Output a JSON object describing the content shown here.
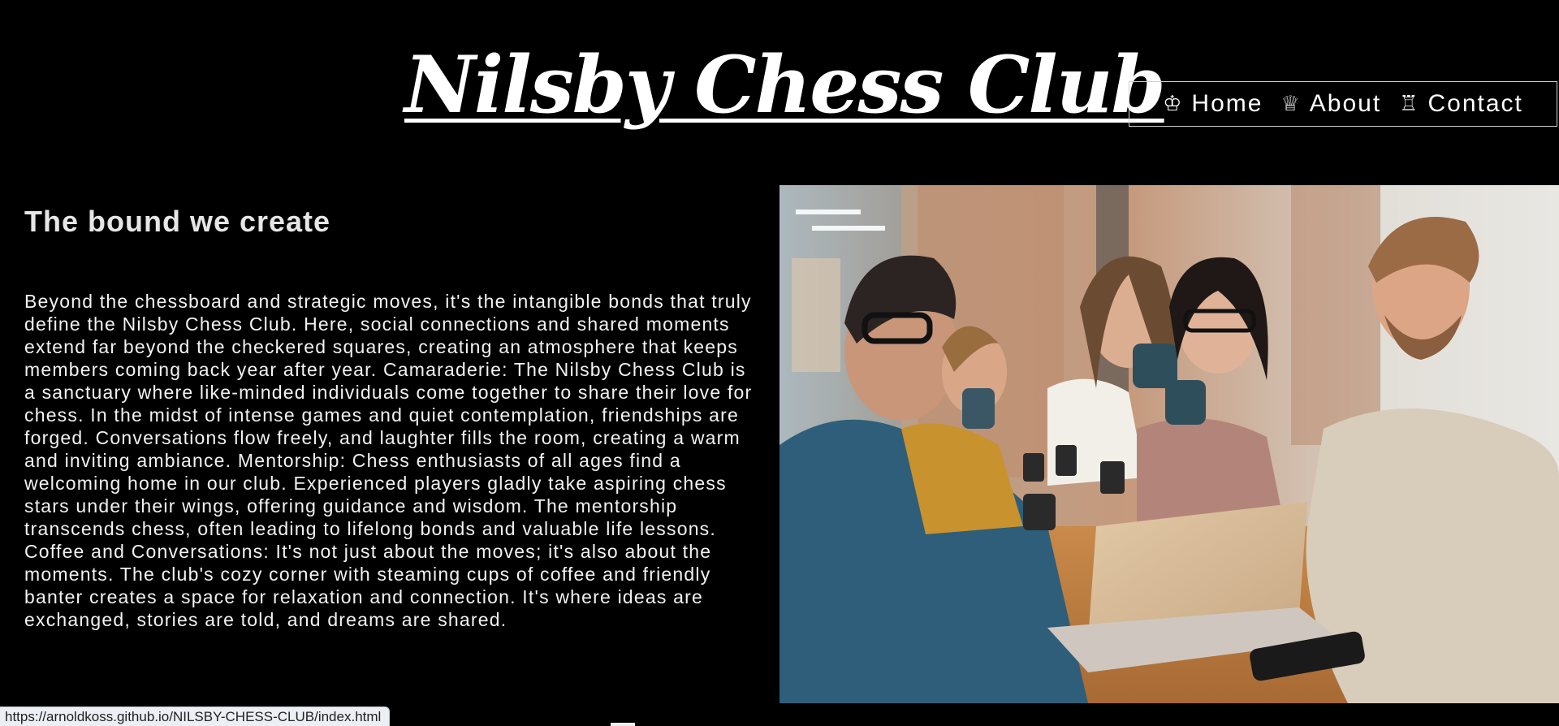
{
  "header": {
    "site_title": "Nilsby Chess Club"
  },
  "nav": {
    "items": [
      {
        "icon": "♔",
        "icon_name": "king-icon",
        "label": "Home"
      },
      {
        "icon": "♕",
        "icon_name": "queen-icon",
        "label": "About"
      },
      {
        "icon": "♖",
        "icon_name": "rook-icon",
        "label": "Contact"
      }
    ]
  },
  "main": {
    "heading": "The bound we create",
    "body": "Beyond the chessboard and strategic moves, it's the intangible bonds that truly define the Nilsby Chess Club. Here, social connections and shared moments extend far beyond the checkered squares, creating an atmosphere that keeps members coming back year after year. Camaraderie: The Nilsby Chess Club is a sanctuary where like-minded individuals come together to share their love for chess. In the midst of intense games and quiet contemplation, friendships are forged. Conversations flow freely, and laughter fills the room, creating a warm and inviting ambiance. Mentorship: Chess enthusiasts of all ages find a welcoming home in our club. Experienced players gladly take aspiring chess stars under their wings, offering guidance and wisdom. The mentorship transcends chess, often leading to lifelong bonds and valuable life lessons. Coffee and Conversations: It's not just about the moves; it's also about the moments. The club's cozy corner with steaming cups of coffee and friendly banter creates a space for relaxation and connection. It's where ideas are exchanged, stories are told, and dreams are shared."
  },
  "status_bar": {
    "url": "https://arnoldkoss.github.io/NILSBY-CHESS-CLUB/index.html"
  },
  "colors": {
    "background": "#000000",
    "text": "#ffffff",
    "nav_border": "#cfcfcf"
  }
}
